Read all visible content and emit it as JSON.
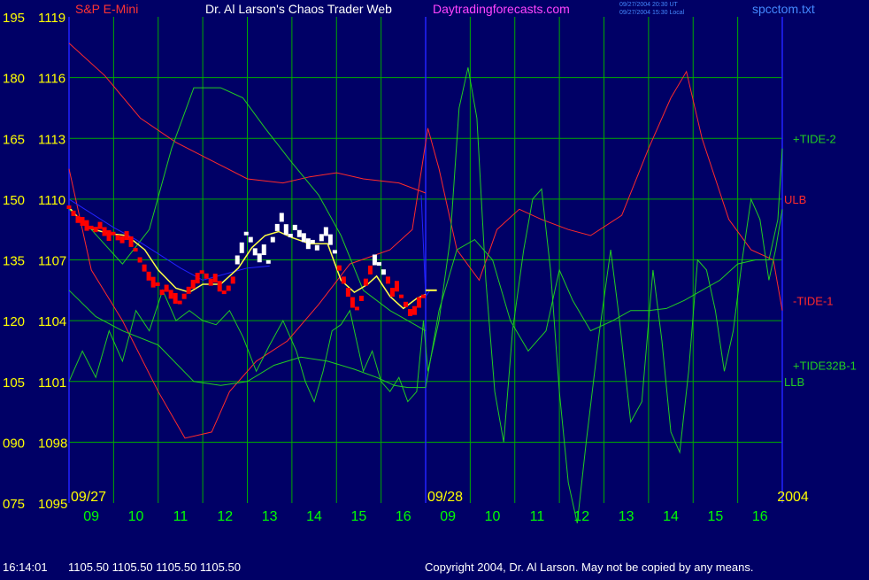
{
  "header": {
    "title_instrument": "S&P E-Mini",
    "title_main": "Dr. Al Larson's Chaos Trader Web",
    "title_site": "Daytradingforecasts.com",
    "timestamp_ut": "09/27/2004 20:30 UT",
    "timestamp_local": "09/27/2004 15:30 Local",
    "file_name": "spcctom.txt"
  },
  "footer": {
    "quote_time": "16:14:01",
    "quote_values": "1105.50 1105.50 1105.50 1105.50",
    "copyright": "Copyright 2004, Dr. Al Larson. May not be copied by any means."
  },
  "colors": {
    "background": "#000066",
    "grid": "#00aa00",
    "axis_text": "#ffff00",
    "hour_text": "#00ff00",
    "price_down": "#ff0000",
    "price_up": "#ffffff",
    "moving_avg": "#ffff44",
    "ulb": "#ff2a2a",
    "tide_green": "#22cc22",
    "blue_line": "#2222ff",
    "title_instrument": "#ff3333",
    "title_main": "#ffffff",
    "title_site": "#ff44ff",
    "timestamp": "#4488ff"
  },
  "chart_data": {
    "type": "line",
    "grid": true,
    "y_left_outer_ticks": [
      "195",
      "180",
      "165",
      "150",
      "135",
      "120",
      "105",
      "090",
      "075"
    ],
    "y_left_inner_ticks": [
      "1119",
      "1116",
      "1113",
      "1110",
      "1107",
      "1104",
      "1101",
      "1098",
      "1095"
    ],
    "ylim": [
      1095,
      1119
    ],
    "xlim": [
      0,
      16
    ],
    "x_ticks": [
      "09",
      "10",
      "11",
      "12",
      "13",
      "14",
      "15",
      "16",
      "09",
      "10",
      "11",
      "12",
      "13",
      "14",
      "15",
      "16"
    ],
    "x_tick_values": [
      0.5,
      1.5,
      2.5,
      3.5,
      4.5,
      5.5,
      6.5,
      7.5,
      8.5,
      9.5,
      10.5,
      11.5,
      12.5,
      13.5,
      14.5,
      15.5
    ],
    "day_labels": [
      {
        "text": "09/27",
        "x": 0
      },
      {
        "text": "09/28",
        "x": 8
      },
      {
        "text": "2004",
        "x": 16
      }
    ],
    "series_labels": [
      {
        "text": "+TIDE-2",
        "y": 1113.0,
        "color_key": "tide_green"
      },
      {
        "text": "ULB",
        "y": 1110.0,
        "color_key": "ulb"
      },
      {
        "text": "-TIDE-1",
        "y": 1105.0,
        "color_key": "ulb"
      },
      {
        "text": "+TIDE32B-1",
        "y": 1101.8,
        "color_key": "tide_green"
      },
      {
        "text": "LLB",
        "y": 1101.0,
        "color_key": "tide_green"
      }
    ],
    "series": [
      {
        "color_key": "ulb",
        "points": [
          [
            0,
            1117.7
          ],
          [
            0.8,
            1116.1
          ],
          [
            1.6,
            1114.0
          ],
          [
            2.4,
            1112.8
          ],
          [
            3.2,
            1111.9
          ],
          [
            4.0,
            1111.0
          ],
          [
            4.8,
            1110.8
          ],
          [
            5.4,
            1111.1
          ],
          [
            6.0,
            1111.3
          ],
          [
            6.6,
            1111.0
          ],
          [
            7.4,
            1110.8
          ],
          [
            8.0,
            1110.3
          ]
        ]
      },
      {
        "color_key": "ulb",
        "points": [
          [
            0,
            1111.5
          ],
          [
            0.5,
            1106.5
          ],
          [
            1.2,
            1104.0
          ],
          [
            2.0,
            1100.5
          ],
          [
            2.6,
            1098.2
          ],
          [
            3.2,
            1098.5
          ],
          [
            3.6,
            1100.5
          ],
          [
            4.2,
            1102.0
          ],
          [
            4.9,
            1103.0
          ],
          [
            5.6,
            1104.8
          ],
          [
            6.3,
            1106.8
          ],
          [
            7.2,
            1107.5
          ],
          [
            7.7,
            1108.5
          ],
          [
            8.05,
            1113.5
          ],
          [
            8.3,
            1111.5
          ],
          [
            8.7,
            1107.5
          ],
          [
            9.2,
            1106.0
          ],
          [
            9.6,
            1108.5
          ],
          [
            10.1,
            1109.5
          ],
          [
            10.6,
            1109.0
          ],
          [
            11.2,
            1108.5
          ],
          [
            11.7,
            1108.2
          ],
          [
            12.4,
            1109.2
          ],
          [
            13.0,
            1112.5
          ],
          [
            13.5,
            1115.0
          ],
          [
            13.85,
            1116.3
          ],
          [
            14.2,
            1113.0
          ],
          [
            14.8,
            1109.0
          ],
          [
            15.3,
            1107.5
          ],
          [
            15.8,
            1107.0
          ],
          [
            16.0,
            1104.5
          ]
        ]
      },
      {
        "color_key": "tide_green",
        "points": [
          [
            0,
            1109.5
          ],
          [
            0.5,
            1108.5
          ],
          [
            1.2,
            1106.8
          ],
          [
            1.8,
            1108.5
          ],
          [
            2.3,
            1112.5
          ],
          [
            2.8,
            1115.5
          ],
          [
            3.4,
            1115.5
          ],
          [
            3.9,
            1115.0
          ],
          [
            4.4,
            1113.5
          ],
          [
            5.0,
            1111.8
          ],
          [
            5.6,
            1110.2
          ],
          [
            6.1,
            1108.2
          ],
          [
            6.6,
            1105.5
          ],
          [
            7.2,
            1104.5
          ],
          [
            7.6,
            1104.0
          ],
          [
            8.0,
            1103.5
          ]
        ]
      },
      {
        "color_key": "tide_green",
        "points": [
          [
            0,
            1105.5
          ],
          [
            0.6,
            1104.2
          ],
          [
            1.2,
            1103.5
          ],
          [
            2.0,
            1102.8
          ],
          [
            2.8,
            1101.0
          ],
          [
            3.4,
            1100.8
          ],
          [
            4.0,
            1101.0
          ],
          [
            4.6,
            1101.8
          ],
          [
            5.2,
            1102.2
          ],
          [
            5.8,
            1102.0
          ],
          [
            6.4,
            1101.6
          ],
          [
            6.9,
            1101.2
          ],
          [
            7.3,
            1100.8
          ],
          [
            7.6,
            1100.7
          ],
          [
            8.0,
            1100.7
          ]
        ]
      },
      {
        "color_key": "tide_green",
        "points": [
          [
            0,
            1101.0
          ],
          [
            0.3,
            1102.5
          ],
          [
            0.6,
            1101.2
          ],
          [
            0.9,
            1103.5
          ],
          [
            1.2,
            1102.0
          ],
          [
            1.5,
            1104.5
          ],
          [
            1.8,
            1103.5
          ],
          [
            2.1,
            1105.5
          ],
          [
            2.4,
            1104.0
          ],
          [
            2.7,
            1104.5
          ],
          [
            3.0,
            1104.0
          ],
          [
            3.3,
            1103.8
          ],
          [
            3.6,
            1104.5
          ],
          [
            3.9,
            1103.2
          ],
          [
            4.2,
            1101.5
          ],
          [
            4.5,
            1102.8
          ],
          [
            4.8,
            1104.0
          ],
          [
            5.1,
            1102.5
          ],
          [
            5.3,
            1101.0
          ],
          [
            5.5,
            1100.0
          ],
          [
            5.7,
            1101.5
          ],
          [
            5.9,
            1103.5
          ],
          [
            6.1,
            1103.8
          ],
          [
            6.3,
            1104.5
          ],
          [
            6.6,
            1101.5
          ],
          [
            6.8,
            1102.5
          ],
          [
            7.0,
            1101.0
          ],
          [
            7.2,
            1100.5
          ],
          [
            7.4,
            1101.2
          ],
          [
            7.6,
            1100.0
          ],
          [
            7.8,
            1100.5
          ],
          [
            7.95,
            1104.0
          ],
          [
            8.05,
            1101.5
          ],
          [
            8.3,
            1104.0
          ],
          [
            8.55,
            1108.0
          ],
          [
            8.75,
            1114.5
          ],
          [
            8.95,
            1116.5
          ],
          [
            9.15,
            1114.0
          ],
          [
            9.35,
            1106.0
          ],
          [
            9.55,
            1100.5
          ],
          [
            9.75,
            1098.0
          ],
          [
            9.95,
            1103.5
          ],
          [
            10.2,
            1107.5
          ],
          [
            10.4,
            1110.0
          ],
          [
            10.6,
            1110.5
          ],
          [
            10.8,
            1106.5
          ],
          [
            11.0,
            1100.5
          ],
          [
            11.2,
            1096.0
          ],
          [
            11.4,
            1094.0
          ],
          [
            11.6,
            1098.0
          ],
          [
            11.9,
            1103.5
          ],
          [
            12.15,
            1107.5
          ],
          [
            12.35,
            1104.0
          ],
          [
            12.6,
            1099.0
          ],
          [
            12.85,
            1100.0
          ],
          [
            13.1,
            1106.5
          ],
          [
            13.3,
            1103.0
          ],
          [
            13.5,
            1098.5
          ],
          [
            13.7,
            1097.5
          ],
          [
            13.9,
            1101.5
          ],
          [
            14.1,
            1107.0
          ],
          [
            14.3,
            1106.5
          ],
          [
            14.5,
            1104.5
          ],
          [
            14.7,
            1101.5
          ],
          [
            14.9,
            1103.5
          ],
          [
            15.1,
            1107.0
          ],
          [
            15.3,
            1110.0
          ],
          [
            15.5,
            1109.0
          ],
          [
            15.7,
            1106.0
          ],
          [
            15.85,
            1107.5
          ],
          [
            16.0,
            1109.5
          ]
        ]
      },
      {
        "color_key": "tide_green",
        "points": [
          [
            8.0,
            1100.7
          ],
          [
            8.3,
            1104.5
          ],
          [
            8.7,
            1107.5
          ],
          [
            9.1,
            1108.0
          ],
          [
            9.5,
            1107.0
          ],
          [
            9.9,
            1104.0
          ],
          [
            10.3,
            1102.5
          ],
          [
            10.7,
            1103.5
          ],
          [
            11.0,
            1106.5
          ],
          [
            11.3,
            1105.0
          ],
          [
            11.7,
            1103.5
          ],
          [
            12.2,
            1104.0
          ],
          [
            12.6,
            1104.5
          ],
          [
            13.0,
            1104.5
          ],
          [
            13.4,
            1104.6
          ],
          [
            13.8,
            1105.0
          ],
          [
            14.2,
            1105.5
          ],
          [
            14.6,
            1106.0
          ],
          [
            15.0,
            1106.8
          ],
          [
            15.4,
            1107.0
          ],
          [
            15.7,
            1107.0
          ],
          [
            15.9,
            1109.0
          ],
          [
            16.0,
            1112.5
          ]
        ]
      },
      {
        "color_key": "blue_line",
        "points": [
          [
            0,
            1110.0
          ],
          [
            0.5,
            1109.3
          ],
          [
            1.0,
            1108.6
          ],
          [
            1.5,
            1108.0
          ],
          [
            2.0,
            1107.3
          ],
          [
            2.5,
            1106.6
          ],
          [
            3.0,
            1106.0
          ],
          [
            3.5,
            1106.3
          ],
          [
            4.0,
            1106.6
          ],
          [
            4.5,
            1106.7
          ]
        ]
      },
      {
        "color_key": "blue_line",
        "points": [
          [
            7.9,
            1110.2
          ],
          [
            8.0,
            1105.2
          ],
          [
            8.1,
            1105.5
          ]
        ]
      },
      {
        "color_key": "moving_avg",
        "points": [
          [
            0,
            1109.6
          ],
          [
            0.4,
            1108.6
          ],
          [
            0.9,
            1108.3
          ],
          [
            1.3,
            1108.2
          ],
          [
            1.7,
            1107.5
          ],
          [
            2.0,
            1106.5
          ],
          [
            2.4,
            1105.6
          ],
          [
            2.7,
            1105.4
          ],
          [
            3.0,
            1105.8
          ],
          [
            3.4,
            1105.8
          ],
          [
            3.8,
            1106.6
          ],
          [
            4.1,
            1107.6
          ],
          [
            4.4,
            1108.2
          ],
          [
            4.7,
            1108.4
          ],
          [
            5.0,
            1108.1
          ],
          [
            5.4,
            1107.8
          ],
          [
            5.8,
            1107.8
          ],
          [
            6.1,
            1106.0
          ],
          [
            6.4,
            1105.4
          ],
          [
            6.7,
            1105.8
          ],
          [
            6.9,
            1106.2
          ],
          [
            7.2,
            1105.2
          ],
          [
            7.5,
            1104.6
          ],
          [
            7.8,
            1105.1
          ],
          [
            8.0,
            1105.3
          ]
        ]
      },
      {
        "color_key": "moving_avg",
        "points": [
          [
            8.0,
            1105.5
          ],
          [
            8.25,
            1105.5
          ]
        ]
      }
    ],
    "price_bars": [
      [
        "down",
        1109.6
      ],
      [
        "down",
        1109.3
      ],
      [
        "down",
        1109.0
      ],
      [
        "down",
        1108.9
      ],
      [
        "down",
        1108.7
      ],
      [
        "down",
        1108.6
      ],
      [
        "down",
        1108.5
      ],
      [
        "down",
        1108.7
      ],
      [
        "down",
        1108.4
      ],
      [
        "down",
        1108.2
      ],
      [
        "down",
        1108.3
      ],
      [
        "down",
        1108.1
      ],
      [
        "down",
        1108.0
      ],
      [
        "down",
        1108.2
      ],
      [
        "down",
        1107.9
      ],
      [
        "down",
        1107.5
      ],
      [
        "down",
        1107.0
      ],
      [
        "down",
        1106.6
      ],
      [
        "down",
        1106.2
      ],
      [
        "down",
        1105.9
      ],
      [
        "down",
        1105.8
      ],
      [
        "down",
        1105.4
      ],
      [
        "down",
        1105.6
      ],
      [
        "down",
        1105.3
      ],
      [
        "down",
        1105.1
      ],
      [
        "down",
        1104.9
      ],
      [
        "down",
        1105.2
      ],
      [
        "down",
        1105.5
      ],
      [
        "down",
        1105.8
      ],
      [
        "down",
        1106.1
      ],
      [
        "down",
        1106.4
      ],
      [
        "down",
        1106.2
      ],
      [
        "down",
        1105.9
      ],
      [
        "down",
        1106.1
      ],
      [
        "down",
        1105.7
      ],
      [
        "down",
        1105.4
      ],
      [
        "down",
        1105.6
      ],
      [
        "down",
        1106.0
      ],
      [
        "up",
        1107.0
      ],
      [
        "up",
        1107.6
      ],
      [
        "up",
        1108.3
      ],
      [
        "up",
        1108.0
      ],
      [
        "up",
        1107.4
      ],
      [
        "up",
        1107.1
      ],
      [
        "up",
        1107.5
      ],
      [
        "up",
        1106.9
      ],
      [
        "up",
        1108.0
      ],
      [
        "up",
        1108.6
      ],
      [
        "up",
        1109.1
      ],
      [
        "up",
        1108.5
      ],
      [
        "up",
        1108.2
      ],
      [
        "up",
        1108.6
      ],
      [
        "up",
        1108.3
      ],
      [
        "up",
        1108.1
      ],
      [
        "up",
        1107.8
      ],
      [
        "up",
        1107.9
      ],
      [
        "up",
        1107.6
      ],
      [
        "up",
        1108.1
      ],
      [
        "up",
        1108.4
      ],
      [
        "up",
        1108.0
      ],
      [
        "up",
        1107.4
      ],
      [
        "down",
        1106.6
      ],
      [
        "down",
        1106.0
      ],
      [
        "down",
        1105.4
      ],
      [
        "down",
        1104.9
      ],
      [
        "down",
        1104.6
      ],
      [
        "down",
        1105.1
      ],
      [
        "down",
        1105.9
      ],
      [
        "down",
        1106.5
      ],
      [
        "up",
        1107.0
      ],
      [
        "up",
        1106.8
      ],
      [
        "up",
        1106.4
      ],
      [
        "down",
        1106.0
      ],
      [
        "down",
        1105.4
      ],
      [
        "down",
        1105.7
      ],
      [
        "down",
        1105.2
      ],
      [
        "down",
        1104.8
      ],
      [
        "down",
        1104.4
      ],
      [
        "down",
        1104.5
      ],
      [
        "down",
        1104.9
      ],
      [
        "down",
        1105.2
      ]
    ],
    "price_bars_x": [
      0,
      7.95
    ],
    "last_quote": 1105.5
  }
}
